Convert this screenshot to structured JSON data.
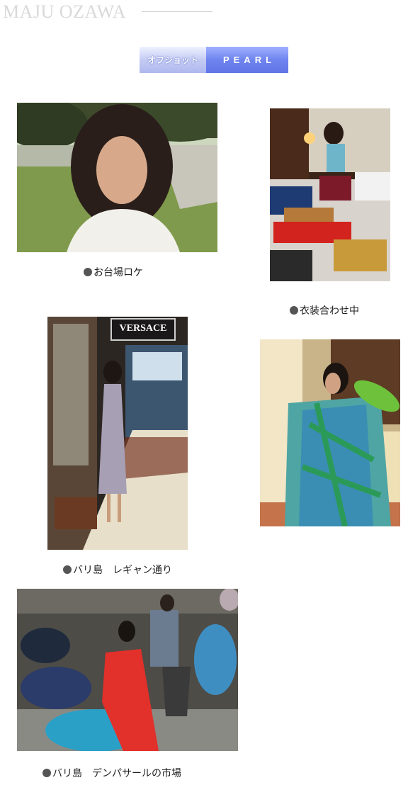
{
  "header": {
    "site_title": "MAJU OZAWA"
  },
  "tabs": {
    "offshot_label": "オフショット",
    "pearl_label": "PEARL"
  },
  "photos": [
    {
      "caption": "お台場ロケ",
      "subject": "woman-in-white-shirt-outdoors"
    },
    {
      "caption": "衣装合わせ中",
      "subject": "woman-sorting-costumes-on-bed"
    },
    {
      "caption": "バリ島　レギャン通り",
      "subject": "woman-on-shopping-street",
      "sign_text": "VERSACE"
    },
    {
      "caption": "",
      "subject": "woman-in-green-blue-shawl"
    },
    {
      "caption": "バリ島　デンパサールの市場",
      "subject": "woman-in-red-dress-on-scooter"
    }
  ]
}
